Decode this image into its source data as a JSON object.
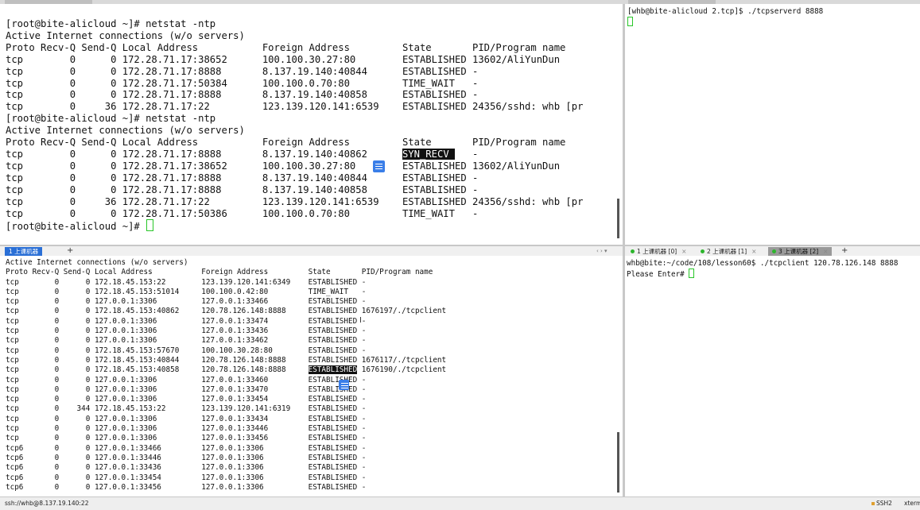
{
  "top_left": {
    "lines": [
      "[root@bite-alicloud ~]# netstat -ntp",
      "Active Internet connections (w/o servers)",
      "Proto Recv-Q Send-Q Local Address           Foreign Address         State       PID/Program name",
      "tcp        0      0 172.28.71.17:38652      100.100.30.27:80        ESTABLISHED 13602/AliYunDun",
      "tcp        0      0 172.28.71.17:8888       8.137.19.140:40844      ESTABLISHED -",
      "tcp        0      0 172.28.71.17:50384      100.100.0.70:80         TIME_WAIT   -",
      "tcp        0      0 172.28.71.17:8888       8.137.19.140:40858      ESTABLISHED -",
      "tcp        0     36 172.28.71.17:22         123.139.120.141:6539    ESTABLISHED 24356/sshd: whb [pr",
      "[root@bite-alicloud ~]# netstat -ntp",
      "Active Internet connections (w/o servers)",
      "Proto Recv-Q Send-Q Local Address           Foreign Address         State       PID/Program name"
    ],
    "syn_line": {
      "prefix": "tcp        0      0 172.28.71.17:8888       8.137.19.140:40862      ",
      "state": "SYN_RECV ",
      "suffix": "   -"
    },
    "lines_after": [
      "tcp        0      0 172.28.71.17:38652      100.100.30.27:80        ESTABLISHED 13602/AliYunDun",
      "tcp        0      0 172.28.71.17:8888       8.137.19.140:40844      ESTABLISHED -",
      "tcp        0      0 172.28.71.17:8888       8.137.19.140:40858      ESTABLISHED -",
      "tcp        0     36 172.28.71.17:22         123.139.120.141:6539    ESTABLISHED 24356/sshd: whb [pr",
      "tcp        0      0 172.28.71.17:50386      100.100.0.70:80         TIME_WAIT   -"
    ],
    "prompt": "[root@bite-alicloud ~]# "
  },
  "top_right": {
    "command_line": "[whb@bite-alicloud 2.tcp]$ ./tcpserverd 8888"
  },
  "bottom_left": {
    "lines_before": [
      "Active Internet connections (w/o servers)",
      "Proto Recv-Q Send-Q Local Address           Foreign Address         State       PID/Program name",
      "tcp        0      0 172.18.45.153:22        123.139.120.141:6349    ESTABLISHED -",
      "tcp        0      0 172.18.45.153:51014     100.100.0.42:80         TIME_WAIT   -",
      "tcp        0      0 127.0.0.1:3306          127.0.0.1:33466         ESTABLISHED -",
      "tcp        0      0 172.18.45.153:40862     120.78.126.148:8888     ESTABLISHED 1676197/./tcpclient",
      "tcp        0      0 127.0.0.1:3306          127.0.0.1:33474         ESTABLISHED -",
      "tcp        0      0 127.0.0.1:3306          127.0.0.1:33436         ESTABLISHED -",
      "tcp        0      0 127.0.0.1:3306          127.0.0.1:33462         ESTABLISHED -",
      "tcp        0      0 172.18.45.153:57670     100.100.30.28:80        ESTABLISHED -",
      "tcp        0      0 172.18.45.153:40844     120.78.126.148:8888     ESTABLISHED 1676117/./tcpclient"
    ],
    "hl_line": {
      "prefix": "tcp        0      0 172.18.45.153:40858     120.78.126.148:8888     ",
      "state": "ESTABLISHED",
      "suffix": " 1676190/./tcpclient"
    },
    "lines_after": [
      "tcp        0      0 127.0.0.1:3306          127.0.0.1:33460         ESTABLISHED -",
      "tcp        0      0 127.0.0.1:3306          127.0.0.1:33470         ESTABLISHED -",
      "tcp        0      0 127.0.0.1:3306          127.0.0.1:33454         ESTABLISHED -",
      "tcp        0    344 172.18.45.153:22        123.139.120.141:6319    ESTABLISHED -",
      "tcp        0      0 127.0.0.1:3306          127.0.0.1:33434         ESTABLISHED -",
      "tcp        0      0 127.0.0.1:3306          127.0.0.1:33446         ESTABLISHED -",
      "tcp        0      0 127.0.0.1:3306          127.0.0.1:33456         ESTABLISHED -",
      "tcp6       0      0 127.0.0.1:33466         127.0.0.1:3306          ESTABLISHED -",
      "tcp6       0      0 127.0.0.1:33446         127.0.0.1:3306          ESTABLISHED -",
      "tcp6       0      0 127.0.0.1:33436         127.0.0.1:3306          ESTABLISHED -",
      "tcp6       0      0 127.0.0.1:33454         127.0.0.1:3306          ESTABLISHED -",
      "tcp6       0      0 127.0.0.1:33456         127.0.0.1:3306          ESTABLISHED -"
    ]
  },
  "bottom_right": {
    "line1": "whb@bite:~/code/108/lesson60$ ./tcpclient 120.78.126.148 8888",
    "line2": "Please Enter# "
  },
  "tabs_left": {
    "active_label": "1 上课机器",
    "add": "+",
    "nav": "‹ ›  ▾"
  },
  "tabs_right": {
    "items": [
      {
        "label": "1 上课机器 [0]"
      },
      {
        "label": "2 上课机器 [1]"
      },
      {
        "label": "3 上课机器 [2]"
      }
    ],
    "add": "+"
  },
  "statusbar": {
    "path": "ssh://whb@8.137.19.140:22",
    "ssh": "SSH2",
    "term": "xterm"
  }
}
